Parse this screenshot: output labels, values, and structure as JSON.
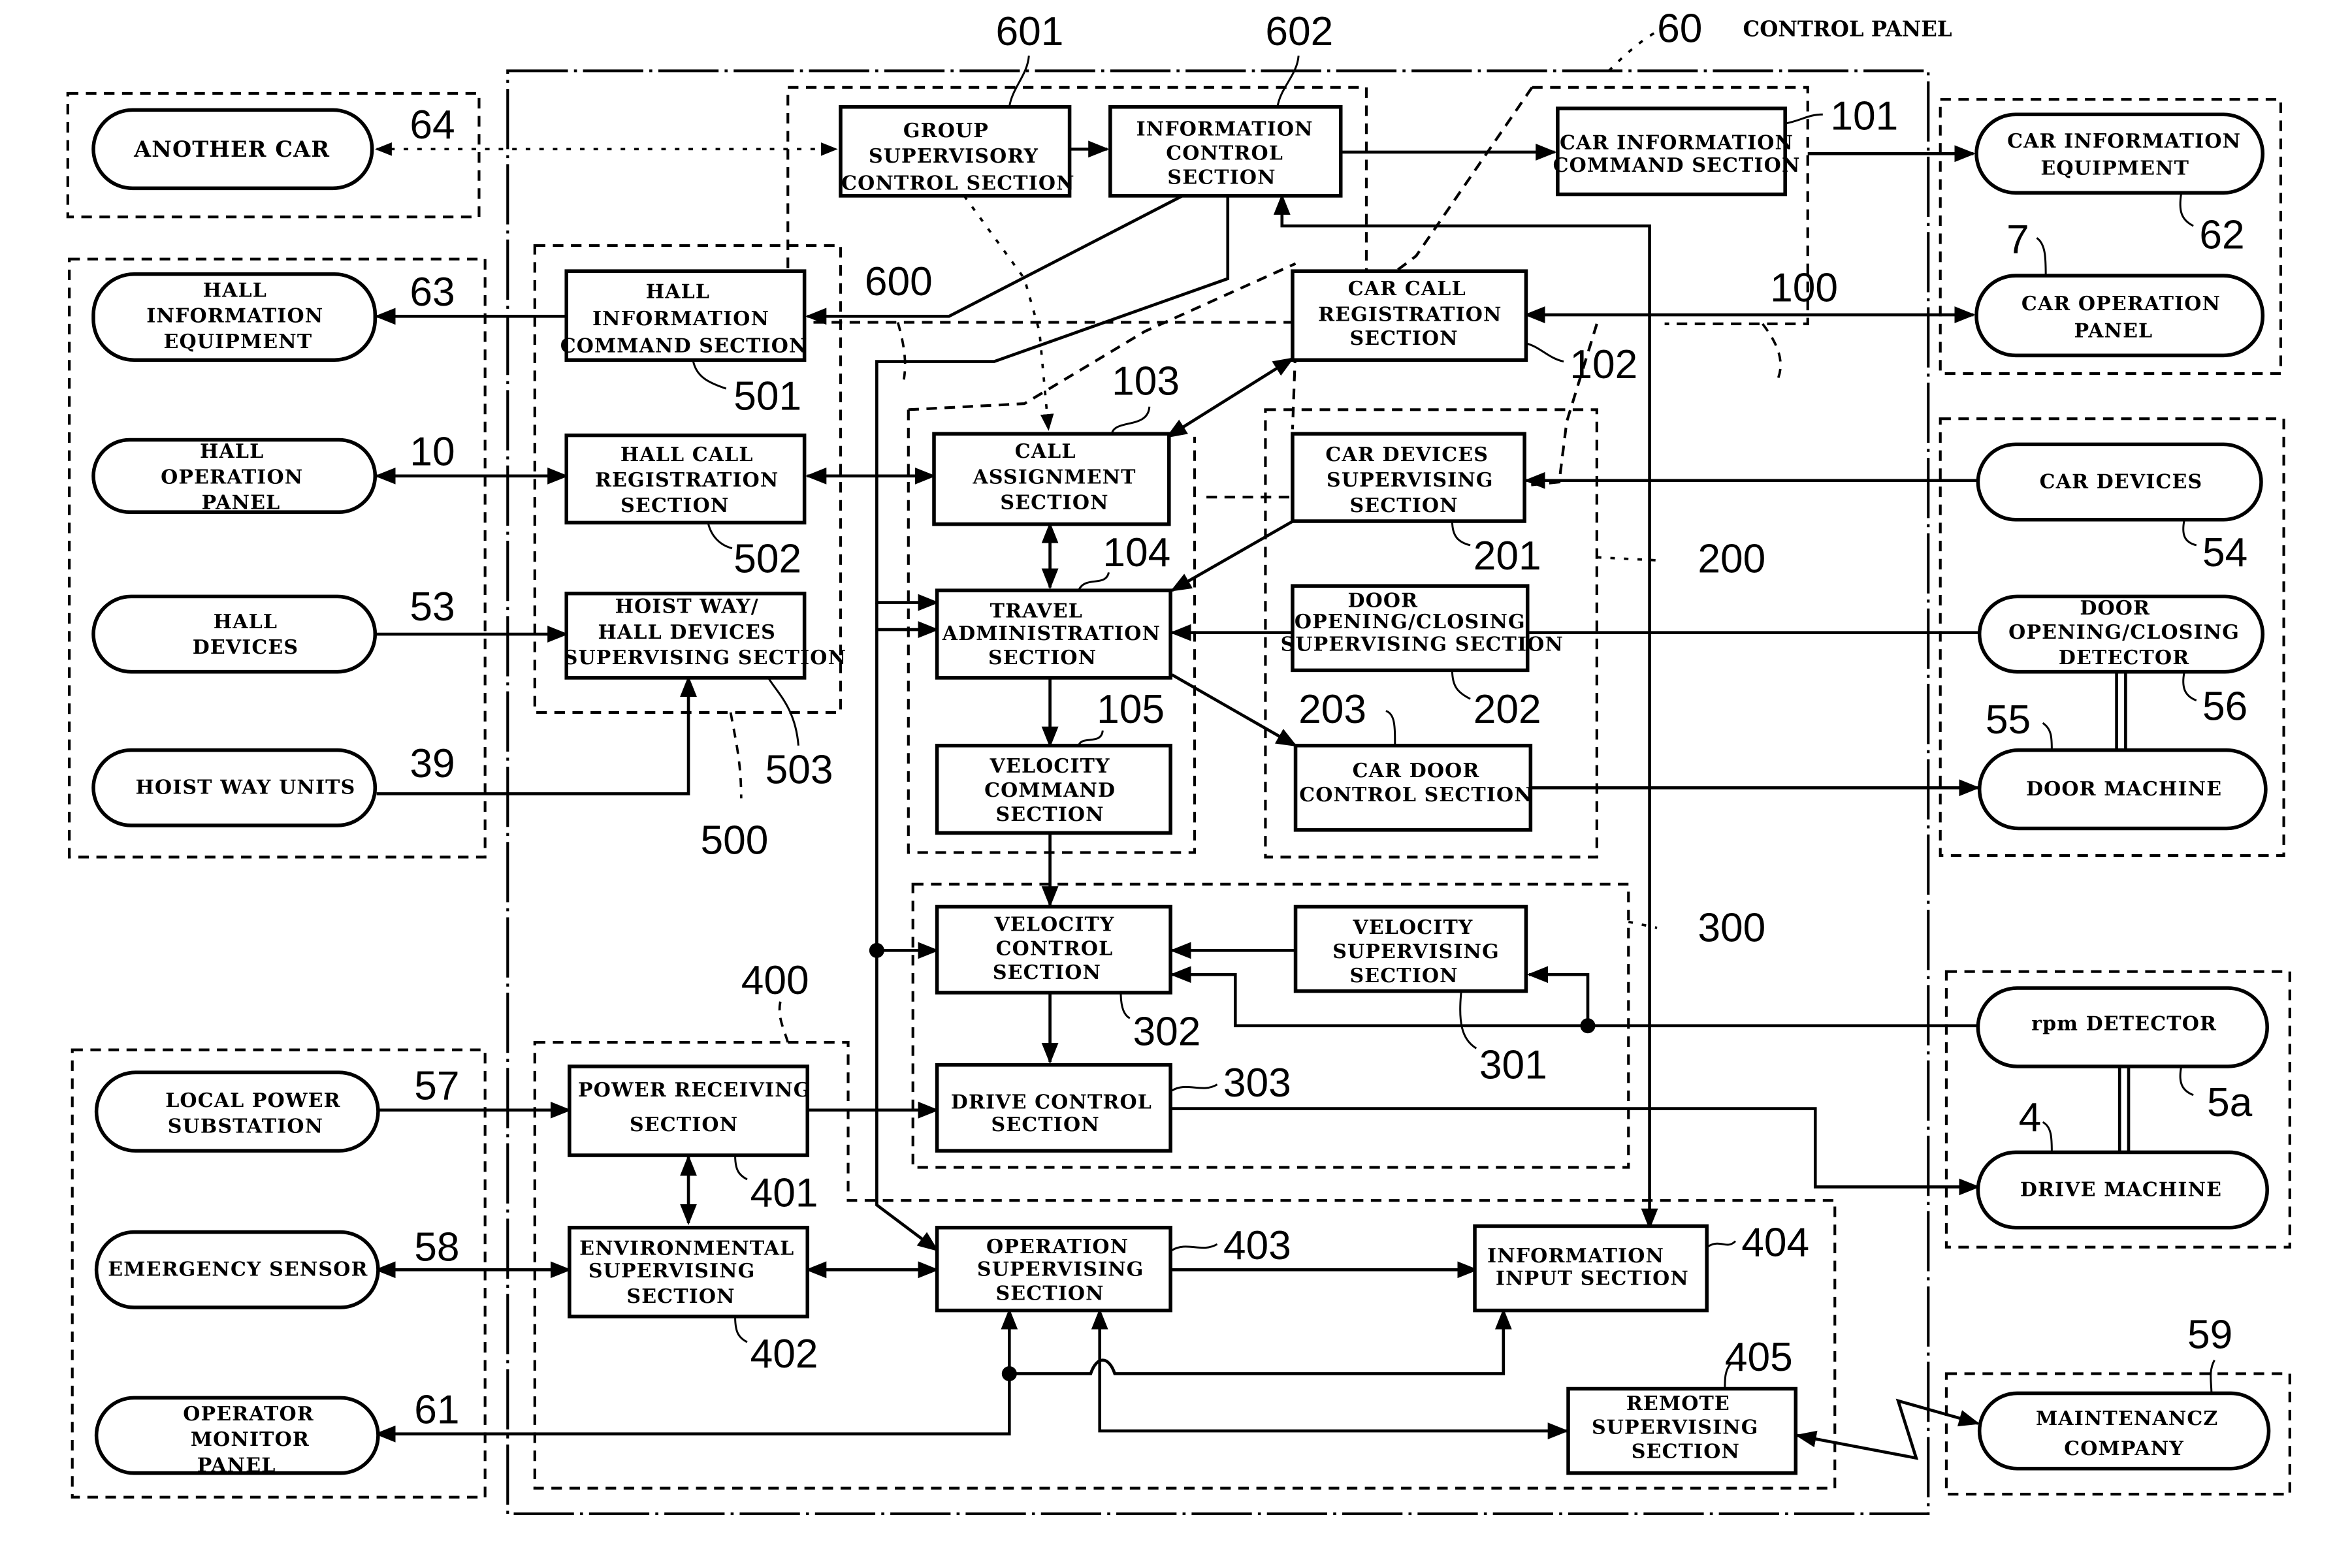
{
  "title": {
    "ref": "60",
    "label": "CONTROL PANEL"
  },
  "external": {
    "another_car": {
      "ref": "64",
      "lines": [
        "ANOTHER CAR"
      ]
    },
    "hall_info_equipment": {
      "ref": "63",
      "lines": [
        "HALL",
        "INFORMATION",
        "EQUIPMENT"
      ]
    },
    "hall_operation_panel": {
      "ref": "10",
      "lines": [
        "HALL",
        "OPERATION",
        "PANEL"
      ]
    },
    "hall_devices": {
      "ref": "53",
      "lines": [
        "HALL",
        "DEVICES"
      ]
    },
    "hoist_way_units": {
      "ref": "39",
      "lines": [
        "HOIST WAY UNITS"
      ]
    },
    "local_power_substation": {
      "ref": "57",
      "lines": [
        "LOCAL POWER",
        "SUBSTATION"
      ]
    },
    "emergency_sensor": {
      "ref": "58",
      "lines": [
        "EMERGENCY SENSOR"
      ]
    },
    "operator_monitor_panel": {
      "ref": "61",
      "lines": [
        "OPERATOR",
        "MONITOR",
        "PANEL"
      ]
    },
    "car_info_equipment": {
      "ref": "62",
      "lines": [
        "CAR INFORMATION",
        "EQUIPMENT"
      ]
    },
    "car_operation_panel": {
      "ref": "7",
      "lines": [
        "CAR OPERATION",
        "PANEL"
      ]
    },
    "car_devices": {
      "ref": "54",
      "lines": [
        "CAR DEVICES"
      ]
    },
    "door_detector": {
      "ref": "56",
      "lines": [
        "DOOR",
        "OPENING/CLOSING",
        "DETECTOR"
      ]
    },
    "door_machine": {
      "ref": "55",
      "lines": [
        "DOOR MACHINE"
      ]
    },
    "rpm_detector": {
      "ref": "5a",
      "lines": [
        "rpm DETECTOR"
      ]
    },
    "drive_machine": {
      "ref": "4",
      "lines": [
        "DRIVE MACHINE"
      ]
    },
    "maintenance_company": {
      "ref": "59",
      "lines": [
        "MAINTENANCZ",
        "COMPANY"
      ]
    }
  },
  "groups": {
    "g600": {
      "ref": "600"
    },
    "g100": {
      "ref": "100"
    },
    "g500": {
      "ref": "500"
    },
    "g200": {
      "ref": "200"
    },
    "g300": {
      "ref": "300"
    },
    "g400": {
      "ref": "400"
    }
  },
  "sections": {
    "s601": {
      "ref": "601",
      "lines": [
        "GROUP",
        "SUPERVISORY",
        "CONTROL SECTION"
      ]
    },
    "s602": {
      "ref": "602",
      "lines": [
        "INFORMATION",
        "CONTROL",
        "SECTION"
      ]
    },
    "s101": {
      "ref": "101",
      "lines": [
        "CAR INFORMATION",
        "COMMAND SECTION"
      ]
    },
    "s102": {
      "ref": "102",
      "lines": [
        "CAR CALL",
        "REGISTRATION",
        "SECTION"
      ]
    },
    "s501": {
      "ref": "501",
      "lines": [
        "HALL",
        "INFORMATION",
        "COMMAND SECTION"
      ]
    },
    "s502": {
      "ref": "502",
      "lines": [
        "HALL CALL",
        "REGISTRATION",
        "SECTION"
      ]
    },
    "s503": {
      "ref": "503",
      "lines": [
        "HOIST WAY/",
        "HALL DEVICES",
        "SUPERVISING SECTION"
      ]
    },
    "s103": {
      "ref": "103",
      "lines": [
        "CALL",
        "ASSIGNMENT",
        "SECTION"
      ]
    },
    "s104": {
      "ref": "104",
      "lines": [
        "TRAVEL",
        "ADMINISTRATION",
        "SECTION"
      ]
    },
    "s105": {
      "ref": "105",
      "lines": [
        "VELOCITY",
        "COMMAND",
        "SECTION"
      ]
    },
    "s201": {
      "ref": "201",
      "lines": [
        "CAR DEVICES",
        "SUPERVISING",
        "SECTION"
      ]
    },
    "s202": {
      "ref": "202",
      "lines": [
        "DOOR",
        "OPENING/CLOSING",
        "SUPERVISING SECTION"
      ]
    },
    "s203": {
      "ref": "203",
      "lines": [
        "CAR DOOR",
        "CONTROL SECTION"
      ]
    },
    "s302": {
      "ref": "302",
      "lines": [
        "VELOCITY",
        "CONTROL",
        "SECTION"
      ]
    },
    "s301": {
      "ref": "301",
      "lines": [
        "VELOCITY",
        "SUPERVISING",
        "SECTION"
      ]
    },
    "s303": {
      "ref": "303",
      "lines": [
        "DRIVE CONTROL",
        "SECTION"
      ]
    },
    "s401": {
      "ref": "401",
      "lines": [
        "POWER RECEIVING",
        "SECTION"
      ]
    },
    "s402": {
      "ref": "402",
      "lines": [
        "ENVIRONMENTAL",
        "SUPERVISING",
        "SECTION"
      ]
    },
    "s403": {
      "ref": "403",
      "lines": [
        "OPERATION",
        "SUPERVISING",
        "SECTION"
      ]
    },
    "s404": {
      "ref": "404",
      "lines": [
        "INFORMATION",
        "INPUT SECTION"
      ]
    },
    "s405": {
      "ref": "405",
      "lines": [
        "REMOTE",
        "SUPERVISING",
        "SECTION"
      ]
    }
  }
}
